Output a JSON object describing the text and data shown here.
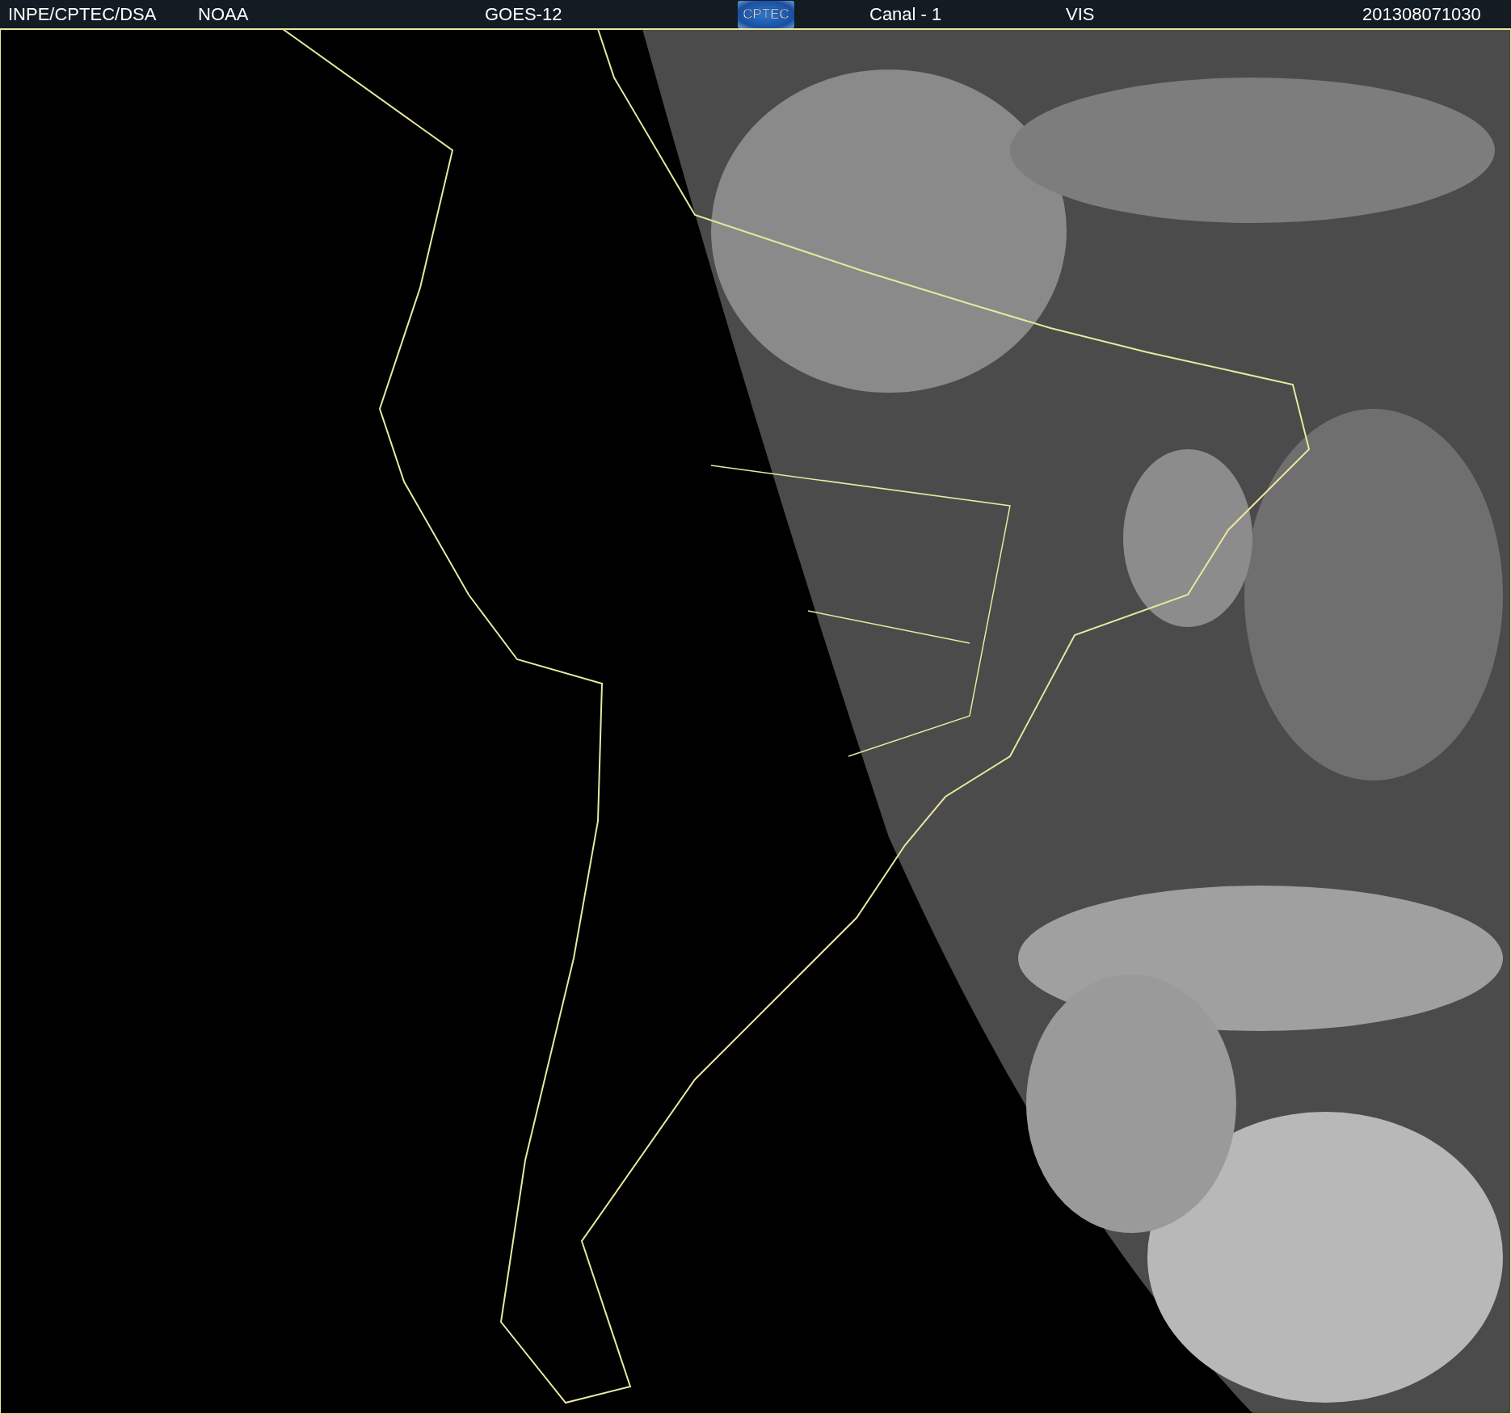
{
  "header": {
    "items": [
      {
        "kind": "text",
        "text": "INPE/CPTEC/DSA"
      },
      {
        "kind": "text",
        "text": "NOAA"
      },
      {
        "kind": "text",
        "text": "GOES-12"
      },
      {
        "kind": "logo",
        "text": "CPTEC"
      },
      {
        "kind": "text",
        "text": "Canal - 1"
      },
      {
        "kind": "text",
        "text": "VIS"
      },
      {
        "kind": "text",
        "text": "201308071030"
      }
    ]
  }
}
